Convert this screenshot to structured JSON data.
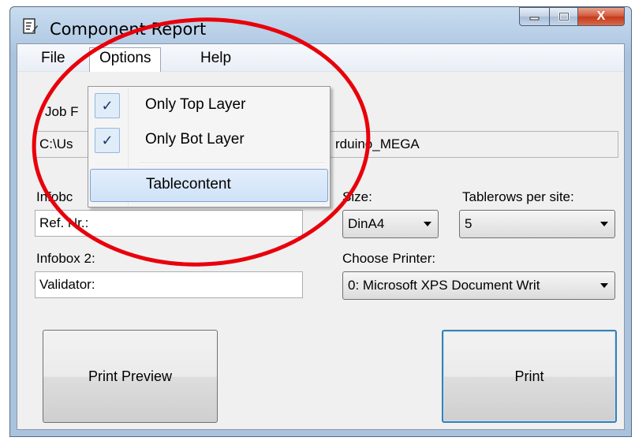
{
  "window": {
    "title": "Component Report",
    "close_glyph": "X"
  },
  "menubar": {
    "items": [
      "File",
      "Options",
      "Help"
    ]
  },
  "options_menu": {
    "items": [
      {
        "label": "Only Top Layer",
        "checked": true
      },
      {
        "label": "Only Bot Layer",
        "checked": true
      },
      {
        "label": "Tablecontent",
        "checked": false
      }
    ],
    "check_glyph": "✓"
  },
  "form": {
    "job_label": "Job F",
    "path_value_left": "C:\\Us",
    "path_value_right": "rduino_MEGA",
    "infobox1_label": "Infobc",
    "infobox1_value": "Ref. Nr.:",
    "infobox2_label": "Infobox 2:",
    "infobox2_value": "Validator:",
    "size_label": "Size:",
    "size_value": "DinA4",
    "tablerows_label": "Tablerows per site:",
    "tablerows_value": "5",
    "printer_label": "Choose Printer:",
    "printer_value": "0: Microsoft XPS Document Writ"
  },
  "buttons": {
    "print_preview": "Print Preview",
    "print": "Print"
  },
  "colors": {
    "annotation": "#e8000b",
    "accent": "#3c7fb1"
  }
}
